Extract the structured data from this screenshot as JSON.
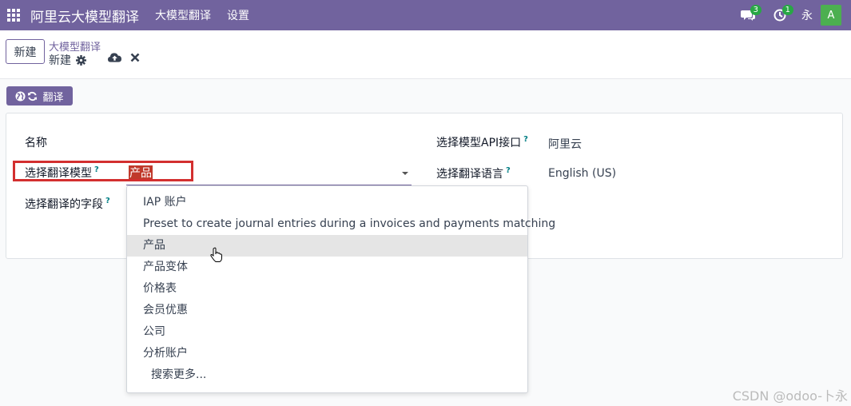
{
  "navbar": {
    "app_name": "阿里云大模型翻译",
    "menus": [
      "大模型翻译",
      "设置"
    ],
    "messages_badge": "3",
    "activities_badge": "1",
    "user_short": "永",
    "avatar_letter": "A",
    "color": "#71639e"
  },
  "control_panel": {
    "new_label": "新建",
    "breadcrumb": "大模型翻译",
    "record_name": "新建"
  },
  "actions": {
    "translate_label": "翻译"
  },
  "form": {
    "name_label": "名称",
    "model_label": "选择翻译模型",
    "model_value": "产品",
    "fields_label": "选择翻译的字段",
    "api_label": "选择模型API接口",
    "api_value": "阿里云",
    "lang_label": "选择翻译语言",
    "lang_value": "English (US)",
    "help_mark": "?"
  },
  "dropdown": {
    "items": [
      "IAP 账户",
      "Preset to create journal entries during a invoices and payments matching",
      "产品",
      "产品变体",
      "价格表",
      "会员优惠",
      "公司",
      "分析账户"
    ],
    "active_index": 2,
    "search_more": "搜索更多..."
  },
  "watermark": "CSDN @odoo-卜永"
}
